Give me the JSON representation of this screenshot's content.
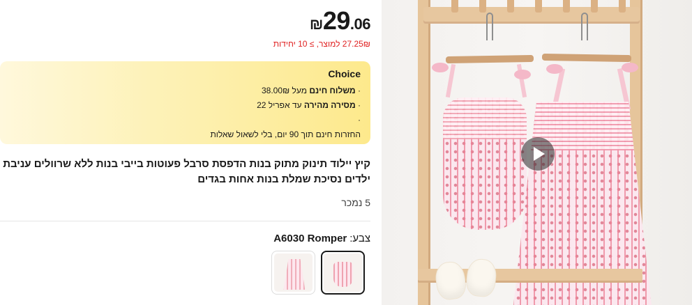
{
  "product": {
    "price_int": "29",
    "price_decimal": ".06",
    "currency": "₪",
    "unit_price_text": "27.25₪ למוצר, ≥ 10 יחידות",
    "title": "קיץ יילוד תינוק מתוק בנות הדפסת סרבל פעוטות בייבי בנות ללא שרוולים עניבת ילדים נסיכת שמלת בנות אחות בגדים",
    "sold_text": "5 נמכר",
    "color_label": "צבע:",
    "color_value": "A6030 Romper"
  },
  "choice": {
    "title": "Choice",
    "free_shipping_prefix": "· ",
    "free_shipping_bold": "משלוח חינם",
    "free_shipping_rest": " מעל 38.00₪",
    "fast_delivery_prefix": "· ",
    "fast_delivery_bold": "מסירה מהירה",
    "fast_delivery_rest": " עד אפריל 22",
    "dot_line": "·",
    "returns": "החזרות חינם תוך 90 יום, בלי לשאול שאלות"
  },
  "media": {
    "play_icon": "play-icon"
  },
  "colors": {
    "price_red": "#e02020",
    "choice_yellow": "#fde98c"
  }
}
